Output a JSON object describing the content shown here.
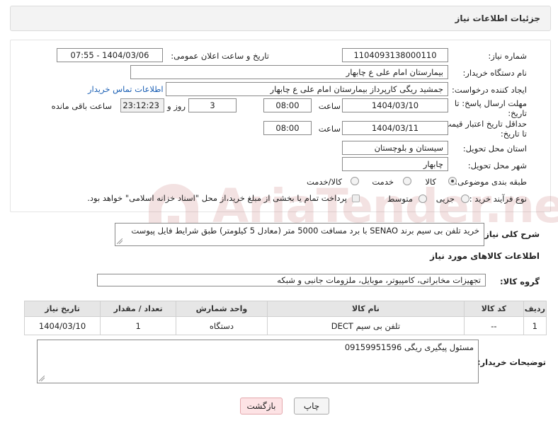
{
  "header": {
    "title": "جزئیات اطلاعات نیاز"
  },
  "form": {
    "need_number_label": "شماره نیاز:",
    "need_number": "1104093138000110",
    "announce_label": "تاریخ و ساعت اعلان عمومی:",
    "announce_value": "1404/03/06 - 07:55",
    "buyer_org_label": "نام دستگاه خریدار:",
    "buyer_org": "بیمارستان امام علی  ع  چابهار",
    "creator_label": "ایجاد کننده درخواست:",
    "creator": "جمشید ریگی کارپرداز بیمارستان امام علی  ع  چابهار",
    "contact_link": "اطلاعات تماس خریدار",
    "deadline_label_1": "مهلت ارسال پاسخ: تا",
    "deadline_label_2": "تاریخ:",
    "deadline_date": "1404/03/10",
    "time_label": "ساعت",
    "deadline_time": "08:00",
    "days_value": "3",
    "days_label": "روز و",
    "remaining_time": "23:12:23",
    "remaining_label": "ساعت باقی مانده",
    "min_price_label_1": "حداقل تاریخ اعتبار قیمت:",
    "min_price_label_2": "تا تاریخ:",
    "min_price_date": "1404/03/11",
    "min_price_time": "08:00",
    "province_label": "استان محل تحویل:",
    "province": "سیستان و بلوچستان",
    "city_label": "شهر محل تحویل:",
    "city": "چابهار",
    "category_label": "طبقه بندی موضوعی:",
    "category_options": [
      "کالا",
      "خدمت",
      "کالا/خدمت"
    ],
    "process_label": "نوع فرآیند خرید :",
    "process_options": [
      "جزیی",
      "متوسط"
    ],
    "payment_note": "پرداخت تمام یا بخشی از مبلغ خرید،از محل \"اسناد خزانه اسلامی\" خواهد بود."
  },
  "summary": {
    "label": "شرح کلی نیاز:",
    "text": "خرید تلفن بی سیم برند SENAO  با  برد مسافت 5000 متر (معادل 5 کیلومتر)      طبق شرایط فایل پیوست"
  },
  "goods": {
    "section_title": "اطلاعات کالاهای مورد نیاز",
    "group_label": "گروه کالا:",
    "group_value": "تجهیزات مخابراتی، کامپیوتر، موبایل، ملزومات جانبی و شبکه",
    "columns": [
      "ردیف",
      "کد کالا",
      "نام کالا",
      "واحد شمارش",
      "تعداد / مقدار",
      "تاریخ نیاز"
    ],
    "rows": [
      [
        "1",
        "--",
        "تلفن بی سیم DECT",
        "دستگاه",
        "1",
        "1404/03/10"
      ]
    ]
  },
  "buyer_notes": {
    "label": "توضیحات خریدار:",
    "text": "مسئول پیگیری ریگی 09159951596"
  },
  "buttons": {
    "print": "چاپ",
    "back": "بازگشت"
  },
  "watermark": {
    "text": "AriaTender.neT"
  },
  "colors": {
    "link": "#1a5fb4",
    "back_button": "#fde3e5",
    "table_header": "#e6e6e6"
  }
}
